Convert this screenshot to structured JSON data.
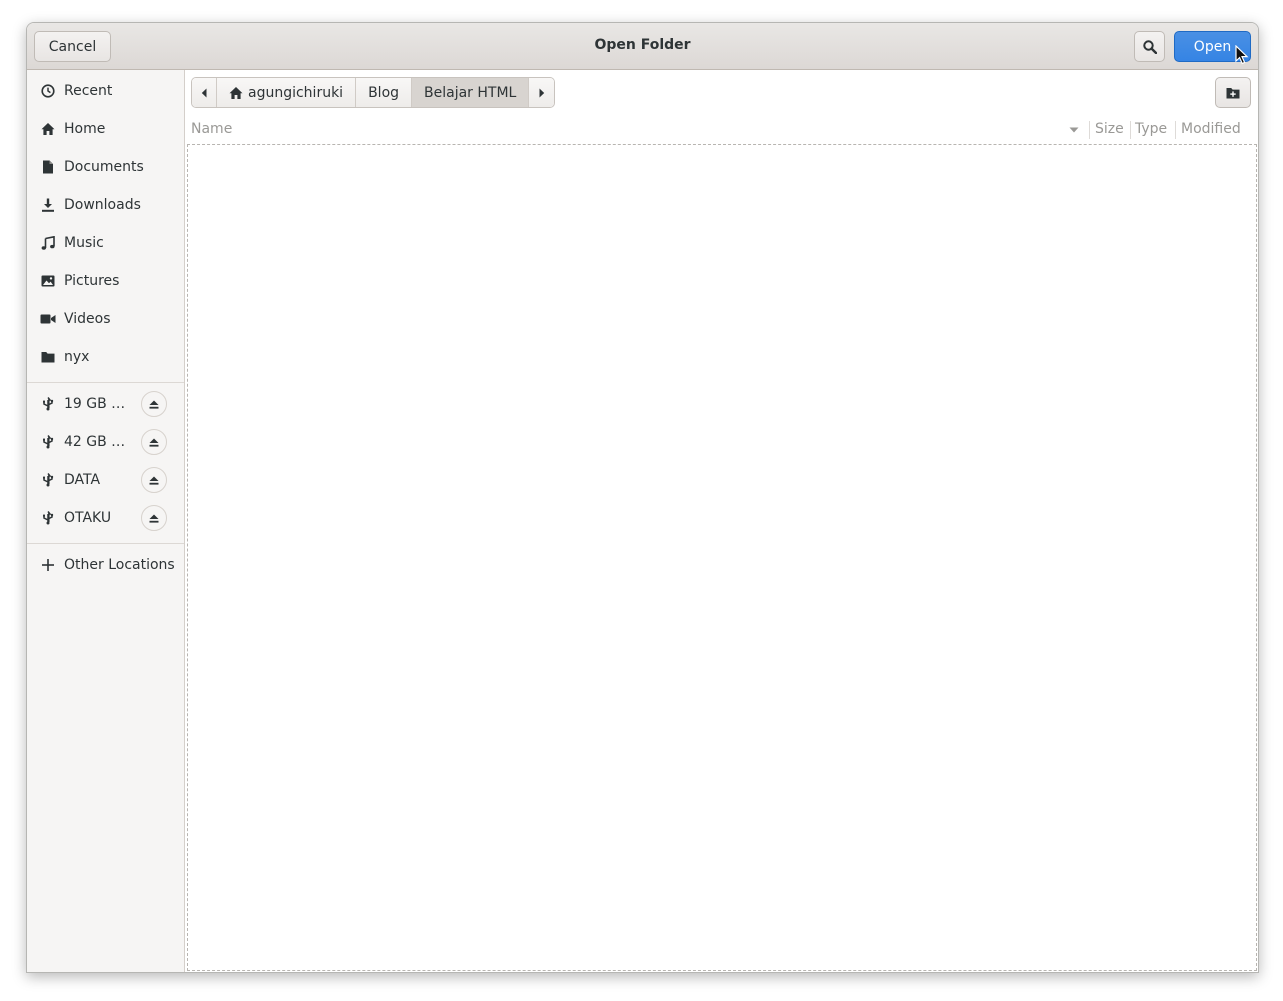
{
  "dialog": {
    "title": "Open Folder",
    "cancel_label": "Cancel",
    "open_label": "Open",
    "accent_color": "#3584e4"
  },
  "sidebar": {
    "places": [
      {
        "label": "Recent",
        "icon": "clock-icon"
      },
      {
        "label": "Home",
        "icon": "home-icon"
      },
      {
        "label": "Documents",
        "icon": "document-icon"
      },
      {
        "label": "Downloads",
        "icon": "download-icon"
      },
      {
        "label": "Music",
        "icon": "music-icon"
      },
      {
        "label": "Pictures",
        "icon": "picture-icon"
      },
      {
        "label": "Videos",
        "icon": "video-icon"
      },
      {
        "label": "nyx",
        "icon": "folder-icon"
      }
    ],
    "devices": [
      {
        "label": "19 GB V…",
        "icon": "usb-icon"
      },
      {
        "label": "42 GB V…",
        "icon": "usb-icon"
      },
      {
        "label": "DATA",
        "icon": "usb-icon"
      },
      {
        "label": "OTAKU",
        "icon": "usb-icon"
      }
    ],
    "other_locations": "Other Locations"
  },
  "pathbar": {
    "segments": [
      "agungichiruki",
      "Blog",
      "Belajar HTML"
    ],
    "active_index": 2
  },
  "columns": {
    "name": "Name",
    "size": "Size",
    "type": "Type",
    "modified": "Modified"
  }
}
